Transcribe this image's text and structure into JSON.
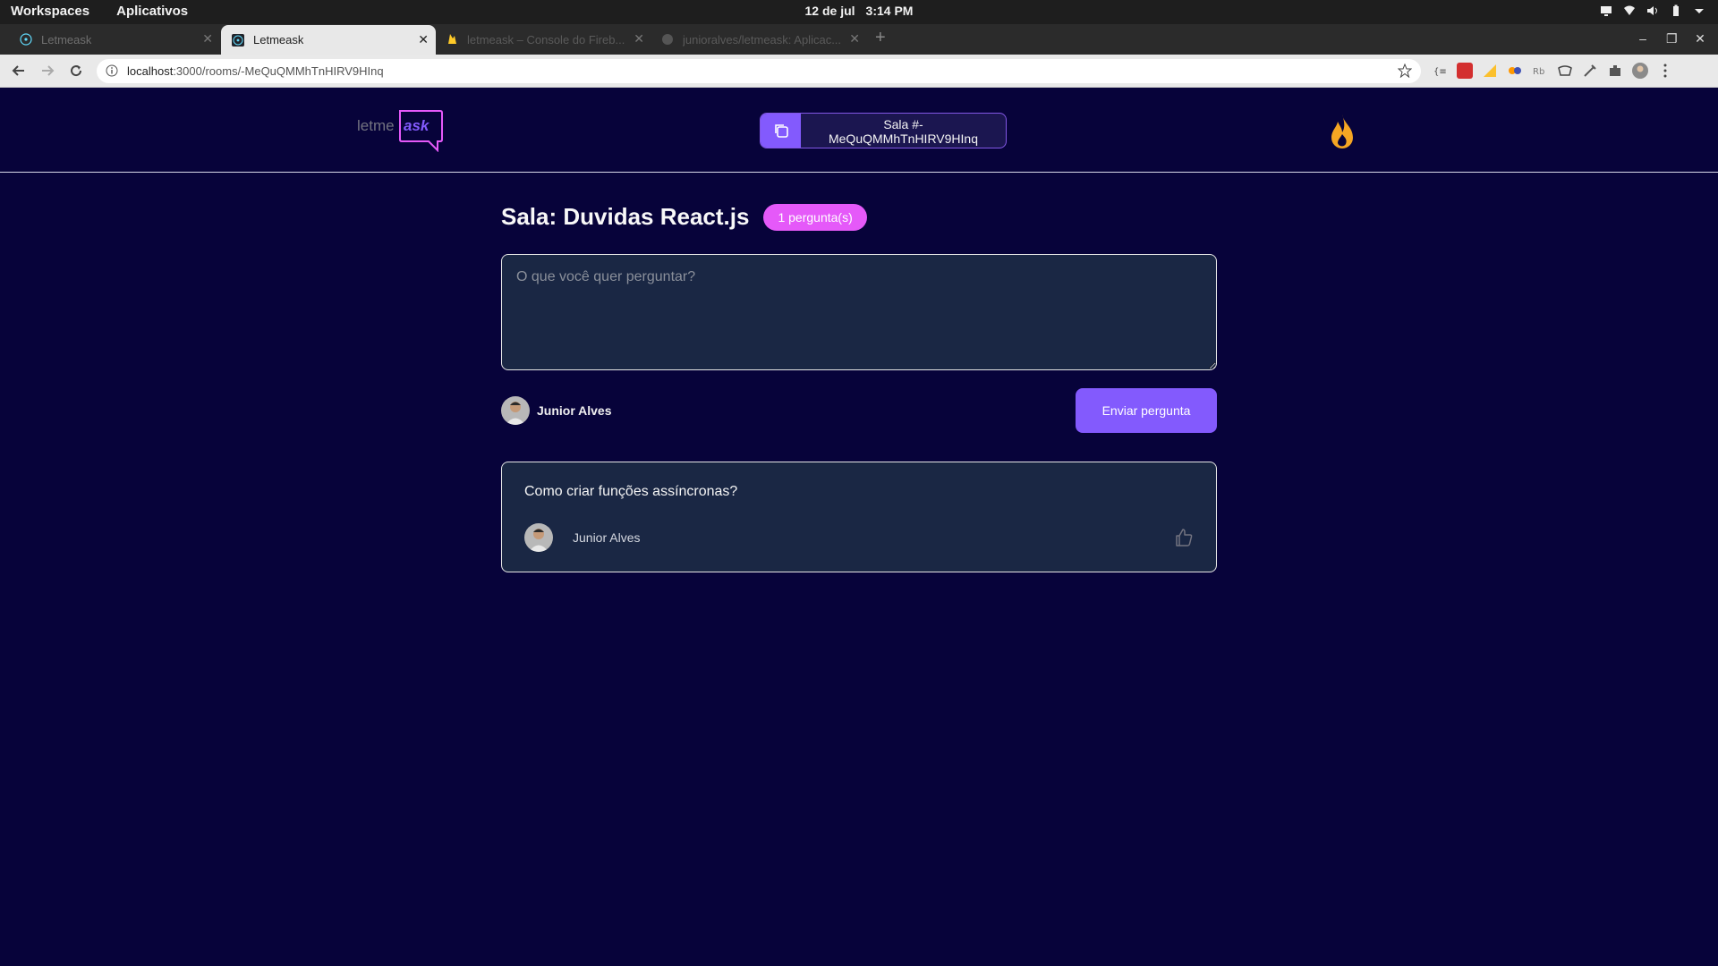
{
  "system_bar": {
    "workspaces": "Workspaces",
    "apps": "Aplicativos",
    "date": "12 de jul",
    "time": "3:14 PM"
  },
  "browser": {
    "tabs": [
      {
        "label": "Letmeask",
        "active": false,
        "favicon": "react-icon"
      },
      {
        "label": "Letmeask",
        "active": true,
        "favicon": "react-icon"
      },
      {
        "label": "letmeask – Console do Fireb...",
        "active": false,
        "favicon": "firebase-icon"
      },
      {
        "label": "junioralves/letmeask: Aplicac...",
        "active": false,
        "favicon": "github-icon"
      }
    ],
    "url_host": "localhost",
    "url_path": ":3000/rooms/-MeQuQMMhTnHIRV9HInq"
  },
  "header": {
    "logo_text_plain": "letme",
    "logo_text_accent": "ask",
    "room_code_line1": "Sala #-",
    "room_code_line2": "MeQuQMMhTnHIRV9HInq"
  },
  "room": {
    "title": "Sala: Duvidas React.js",
    "question_count": "1 pergunta(s)"
  },
  "form": {
    "placeholder": "O que você quer perguntar?",
    "user_name": "Junior Alves",
    "submit_label": "Enviar pergunta"
  },
  "questions": [
    {
      "content": "Como criar funções assíncronas?",
      "author": "Junior Alves"
    }
  ],
  "colors": {
    "background": "#07033a",
    "primary": "#835afd",
    "pink": "#e559f9",
    "card": "#1a2744",
    "flame": "#f5a623"
  }
}
